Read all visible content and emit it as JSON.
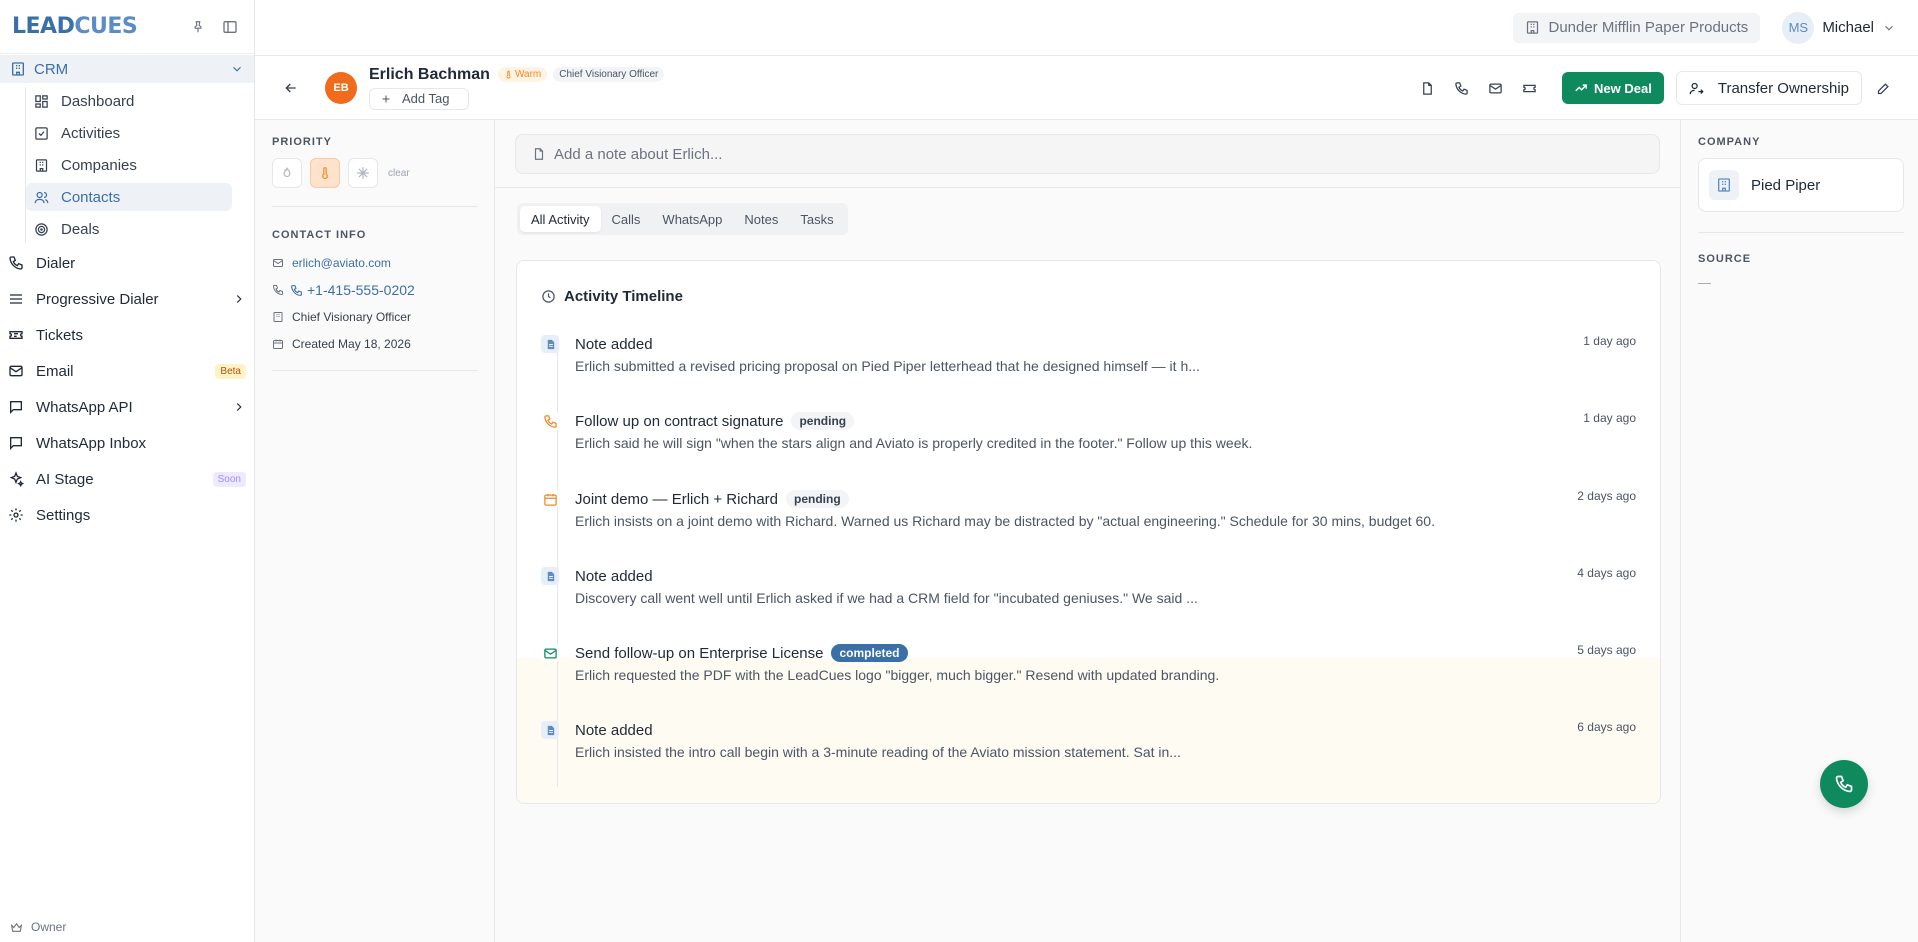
{
  "app": {
    "logo_a": "LEAD",
    "logo_b": "CUES"
  },
  "sidebar": {
    "crm_label": "CRM",
    "sub_items": [
      {
        "label": "Dashboard"
      },
      {
        "label": "Activities"
      },
      {
        "label": "Companies"
      },
      {
        "label": "Contacts"
      },
      {
        "label": "Deals"
      }
    ],
    "items": [
      {
        "label": "Dialer"
      },
      {
        "label": "Progressive Dialer"
      },
      {
        "label": "Tickets"
      },
      {
        "label": "Email",
        "badge": "Beta"
      },
      {
        "label": "WhatsApp API"
      },
      {
        "label": "WhatsApp Inbox"
      },
      {
        "label": "AI Stage",
        "badge": "Soon"
      },
      {
        "label": "Settings"
      }
    ],
    "role": "Owner"
  },
  "topbar": {
    "org": "Dunder Mifflin Paper Products",
    "user_initials": "MS",
    "user_name": "Michael"
  },
  "contact": {
    "initials": "EB",
    "name": "Erlich Bachman",
    "temperature": "Warm",
    "title": "Chief Visionary Officer",
    "add_tag": "Add Tag",
    "new_deal": "New Deal",
    "transfer": "Transfer Ownership"
  },
  "left_panel": {
    "priority_label": "PRIORITY",
    "clear": "clear",
    "contact_info_label": "CONTACT INFO",
    "email": "erlich@aviato.com",
    "phone": "+1-415-555-0202",
    "job_title": "Chief Visionary Officer",
    "created": "Created May 18, 2026"
  },
  "center": {
    "note_placeholder": "Add a note about Erlich...",
    "tabs": [
      {
        "label": "All Activity"
      },
      {
        "label": "Calls"
      },
      {
        "label": "WhatsApp"
      },
      {
        "label": "Notes"
      },
      {
        "label": "Tasks"
      }
    ],
    "timeline_title": "Activity Timeline",
    "events": [
      {
        "icon": "note-icon",
        "title": "Note added",
        "status": "",
        "desc": "Erlich submitted a revised pricing proposal on Pied Piper letterhead that he designed himself — it h...",
        "time": "1 day ago"
      },
      {
        "icon": "phone-icon",
        "title": "Follow up on contract signature",
        "status": "pending",
        "desc": "Erlich said he will sign \"when the stars align and Aviato is properly credited in the footer.\" Follow up this week.",
        "time": "1 day ago"
      },
      {
        "icon": "calendar-icon",
        "title": "Joint demo — Erlich + Richard",
        "status": "pending",
        "desc": "Erlich insists on a joint demo with Richard. Warned us Richard may be distracted by \"actual engineering.\" Schedule for 30 mins, budget 60.",
        "time": "2 days ago"
      },
      {
        "icon": "note-icon",
        "title": "Note added",
        "status": "",
        "desc": "Discovery call went well until Erlich asked if we had a CRM field for \"incubated geniuses.\" We said ...",
        "time": "4 days ago"
      },
      {
        "icon": "mail-icon",
        "title": "Send follow-up on Enterprise License",
        "status": "completed",
        "desc": "Erlich requested the PDF with the LeadCues logo \"bigger, much bigger.\" Resend with updated branding.",
        "time": "5 days ago"
      },
      {
        "icon": "note-icon",
        "title": "Note added",
        "status": "",
        "desc": "Erlich insisted the intro call begin with a 3-minute reading of the Aviato mission statement. Sat in...",
        "time": "6 days ago"
      }
    ]
  },
  "right_panel": {
    "company_label": "COMPANY",
    "company": "Pied Piper",
    "source_label": "SOURCE",
    "source": "—"
  },
  "colors": {
    "accent": "#3b6fa8",
    "primary_green": "#0f8a5f",
    "warm_orange": "#f08a24",
    "avatar_orange": "#f26b1d"
  }
}
